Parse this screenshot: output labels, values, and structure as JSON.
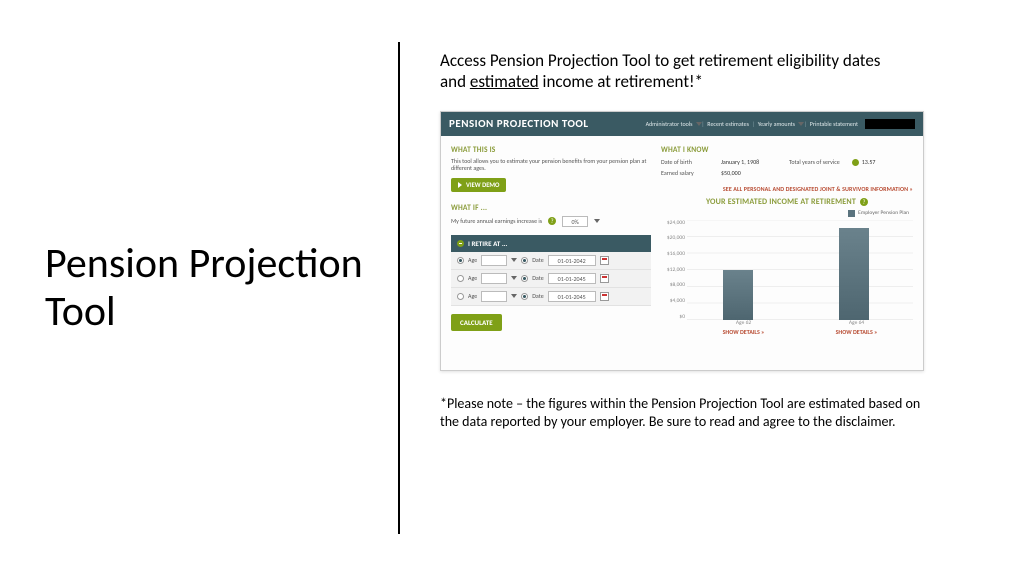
{
  "slide": {
    "title": "Pension Projection Tool",
    "intro_pre": "Access Pension Projection Tool to get retirement eligibility dates and ",
    "intro_underlined": "estimated",
    "intro_post": " income at retirement!*",
    "footnote": "*Please note – the figures within the Pension Projection Tool are estimated based on the data reported by your employer. Be sure to read and agree to the disclaimer."
  },
  "tool": {
    "header": {
      "title": "PENSION PROJECTION TOOL",
      "links": [
        "Administrator tools",
        "Recent estimates",
        "Yearly amounts",
        "Printable statement"
      ]
    },
    "what_this_is": {
      "heading": "WHAT THIS IS",
      "desc": "This tool allows you to estimate your pension benefits from your pension plan at different ages.",
      "view_demo": "VIEW DEMO"
    },
    "what_if": {
      "heading": "WHAT IF ...",
      "earnings_label": "My future annual earnings increase is",
      "earnings_value": "0%"
    },
    "retire_at": {
      "heading": "I RETIRE AT ...",
      "rows": [
        {
          "age_label": "Age",
          "date_label": "Date",
          "date_value": "01-01-2042"
        },
        {
          "age_label": "Age",
          "date_label": "Date",
          "date_value": "01-01-2045"
        },
        {
          "age_label": "Age",
          "date_label": "Date",
          "date_value": "01-01-2045"
        }
      ],
      "calculate": "CALCULATE"
    },
    "what_i_know": {
      "heading": "WHAT I KNOW",
      "dob_label": "Date of birth",
      "dob_value": "January 1, 1908",
      "salary_label": "Earned salary",
      "salary_value": "$50,000",
      "service_label": "Total years of service",
      "service_value": "13.57"
    },
    "right_links": {
      "see_personal": "SEE ALL PERSONAL AND DESIGNATED JOINT & SURVIVOR INFORMATION »"
    },
    "estimate": {
      "heading": "YOUR ESTIMATED INCOME AT RETIREMENT",
      "legend": "Employer Pension Plan",
      "show_details": "SHOW DETAILS »"
    }
  },
  "chart_data": {
    "type": "bar",
    "title": "YOUR ESTIMATED INCOME AT RETIREMENT",
    "categories": [
      "Age 62",
      "Age 64"
    ],
    "series": [
      {
        "name": "Employer Pension Plan",
        "values": [
          12000,
          22000
        ]
      }
    ],
    "xlabel": "",
    "ylabel": "",
    "ylim": [
      0,
      24000
    ],
    "yticks": [
      0,
      4000,
      8000,
      12000,
      16000,
      20000,
      24000
    ],
    "ytick_labels": [
      "$0",
      "$4,000",
      "$8,000",
      "$12,000",
      "$16,000",
      "$20,000",
      "$24,000"
    ]
  }
}
